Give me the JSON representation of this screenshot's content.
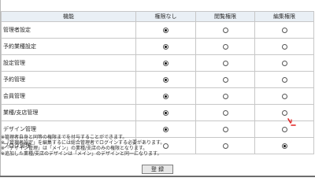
{
  "table": {
    "headers": [
      "機能",
      "権限なし",
      "閲覧権限",
      "編集権限"
    ],
    "rows": [
      {
        "feature": "管理者設定",
        "selected": 0
      },
      {
        "feature": "予約業種設定",
        "selected": 0
      },
      {
        "feature": "設定管理",
        "selected": 0
      },
      {
        "feature": "予約管理",
        "selected": 0
      },
      {
        "feature": "会員管理",
        "selected": 0
      },
      {
        "feature": "業種/支店管理",
        "selected": 0
      },
      {
        "feature": "デザイン管理",
        "selected": 0
      },
      {
        "feature": "ブログ管理",
        "selected": 2
      }
    ]
  },
  "notes": [
    "※管理者自身と同等の権限までを付与することができます。",
    "※「管理者設定」を編集するには総合管理者でログインする必要があります。",
    "※「デザイン管理」は「メイン」の業種/支店のみの権限となります。",
    "※追加した業種/支店のデザインは「メイン」のデザインと同一になります。"
  ],
  "actions": {
    "register_label": "登 録"
  },
  "icons": {
    "cursor": "mouse-pointer-icon"
  },
  "colors": {
    "header_bg": "#e9eff5",
    "border": "#c7c7c7",
    "cursor": "#e02020",
    "bottom_bar": "#6d6d6d"
  }
}
